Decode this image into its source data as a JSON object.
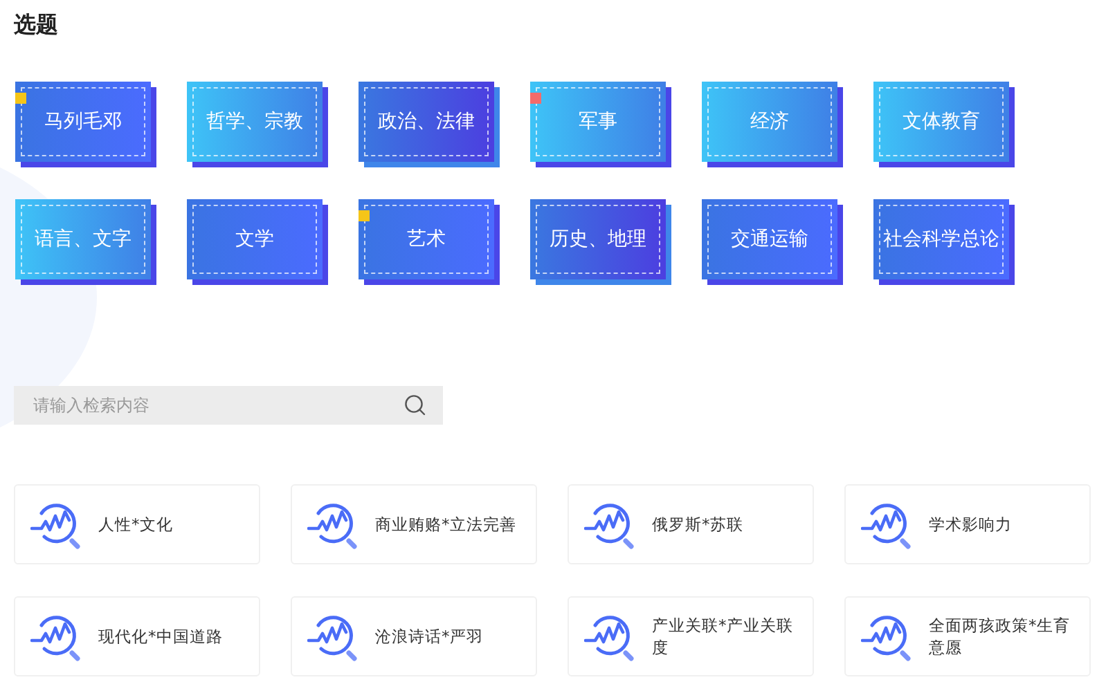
{
  "title": "选题",
  "topics": [
    {
      "label": "马列毛邓",
      "kind": "blue",
      "color": "#f5c518"
    },
    {
      "label": "哲学、宗教",
      "kind": "cyan"
    },
    {
      "label": "政治、法律",
      "kind": "violet"
    },
    {
      "label": "军事",
      "kind": "cyan",
      "color": "#f36b6b"
    },
    {
      "label": "经济",
      "kind": "cyan"
    },
    {
      "label": "文体教育",
      "kind": "cyan"
    },
    {
      "label": "语言、文字",
      "kind": "cyan"
    },
    {
      "label": "文学",
      "kind": "blue"
    },
    {
      "label": "艺术",
      "kind": "blue",
      "color": "#f5c518"
    },
    {
      "label": "历史、地理",
      "kind": "violet"
    },
    {
      "label": "交通运输",
      "kind": "blue"
    },
    {
      "label": "社会科学总论",
      "kind": "blue"
    }
  ],
  "search": {
    "placeholder": "请输入检索内容"
  },
  "results": [
    "人性*文化",
    "商业贿赂*立法完善",
    "俄罗斯*苏联",
    "学术影响力",
    "现代化*中国道路",
    "沧浪诗话*严羽",
    "产业关联*产业关联度",
    "全面两孩政策*生育意愿"
  ]
}
